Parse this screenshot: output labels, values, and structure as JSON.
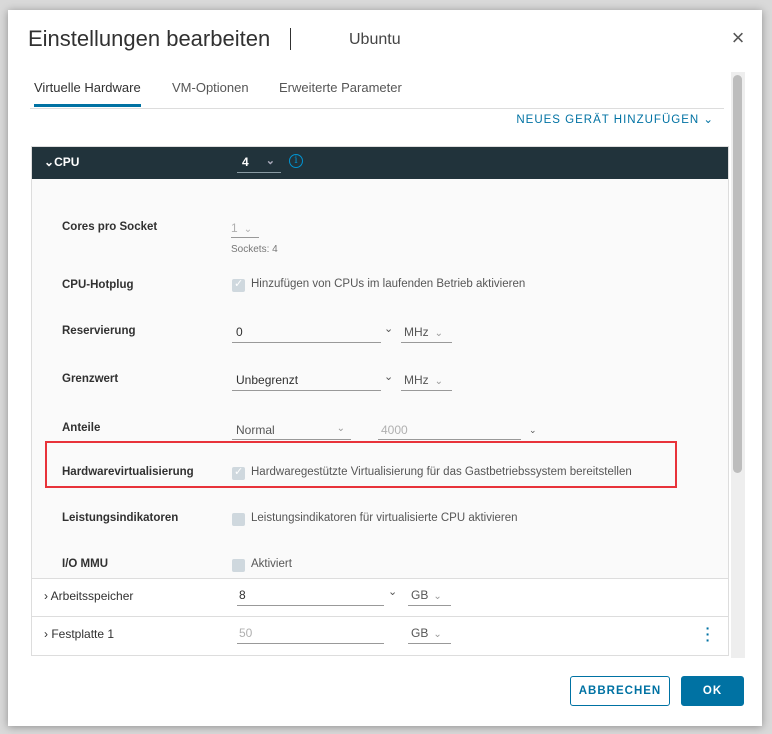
{
  "dialog": {
    "title": "Einstellungen bearbeiten",
    "vm_name": "Ubuntu",
    "close_icon": "×"
  },
  "tabs": [
    {
      "label": "Virtuelle Hardware",
      "active": true
    },
    {
      "label": "VM-Optionen",
      "active": false
    },
    {
      "label": "Erweiterte Parameter",
      "active": false
    }
  ],
  "add_device": "NEUES GERÄT HINZUFÜGEN ⌄",
  "cpu": {
    "title": "CPU",
    "expand_icon": "⌄",
    "value": "4",
    "chevron": "⌄",
    "info_icon": "i",
    "cores_per_socket": {
      "label": "Cores pro Socket",
      "value": "1",
      "hint": "Sockets: 4"
    },
    "hotplug": {
      "label": "CPU-Hotplug",
      "checkbox_label": "Hinzufügen von CPUs im laufenden Betrieb aktivieren",
      "checked": true
    },
    "reservation": {
      "label": "Reservierung",
      "value": "0",
      "unit": "MHz"
    },
    "limit": {
      "label": "Grenzwert",
      "value": "Unbegrenzt",
      "unit": "MHz"
    },
    "shares": {
      "label": "Anteile",
      "value": "Normal",
      "amount": "4000"
    },
    "hw_virt": {
      "label": "Hardwarevirtualisierung",
      "checkbox_label": "Hardwaregestützte Virtualisierung für das Gastbetriebssystem bereitstellen",
      "checked": true
    },
    "perf_counters": {
      "label": "Leistungsindikatoren",
      "checkbox_label": "Leistungsindikatoren für virtualisierte CPU aktivieren",
      "checked": false
    },
    "iommu": {
      "label": "I/O MMU",
      "checkbox_label": "Aktiviert",
      "checked": false
    }
  },
  "memory": {
    "title": "Arbeitsspeicher",
    "value": "8",
    "unit": "GB"
  },
  "disk": {
    "title": "Festplatte 1",
    "value": "50",
    "unit": "GB"
  },
  "buttons": {
    "cancel": "ABBRECHEN",
    "ok": "OK"
  },
  "colors": {
    "accent": "#0072a3",
    "header_bg": "#21333b",
    "highlight": "#e8333a"
  }
}
